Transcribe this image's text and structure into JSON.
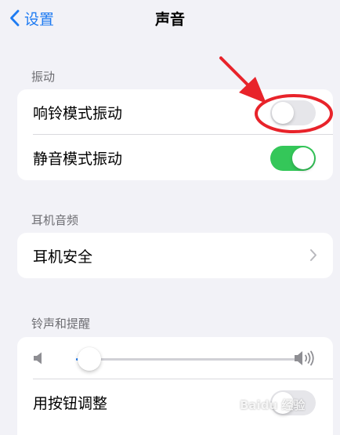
{
  "navbar": {
    "back_label": "设置",
    "title": "声音"
  },
  "sections": {
    "vibration": {
      "header": "振动",
      "rows": [
        {
          "label": "响铃模式振动",
          "toggle_on": false
        },
        {
          "label": "静音模式振动",
          "toggle_on": true
        }
      ]
    },
    "headphone_audio": {
      "header": "耳机音频",
      "rows": [
        {
          "label": "耳机安全"
        }
      ]
    },
    "ringtone_alerts": {
      "header": "铃声和提醒",
      "volume_level": 0.06,
      "rows": [
        {
          "label": "用按钮调整",
          "toggle_on": false
        }
      ]
    }
  },
  "colors": {
    "accent": "#1e7bf2",
    "toggle_on": "#34c759",
    "toggle_off": "#e6e6ea",
    "annotation": "#e8232a"
  },
  "watermark": "Baidu 经验"
}
